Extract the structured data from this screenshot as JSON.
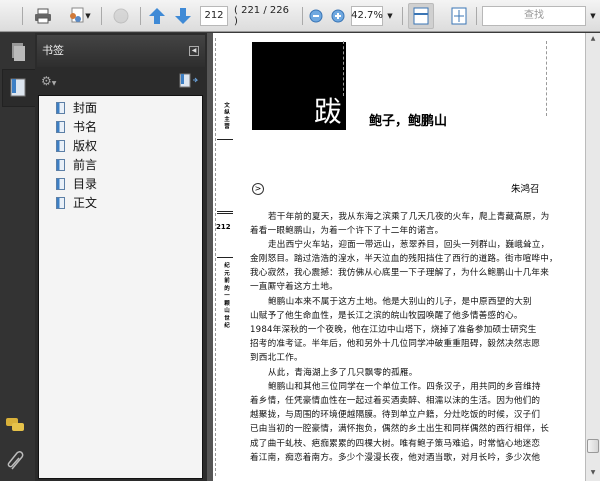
{
  "toolbar": {
    "page_number": "212",
    "page_count": "( 221 / 226 )",
    "zoom": "42.7%",
    "search_placeholder": "查找"
  },
  "panel": {
    "title": "书签",
    "bookmarks": [
      "封面",
      "书名",
      "版权",
      "前言",
      "目录",
      "正文"
    ]
  },
  "document": {
    "drop_char": "跋",
    "title": "鲍子，鲍鹏山",
    "author": "朱鸿召",
    "side_header": "文纵主营",
    "page_number": "212",
    "side_footer": "纪元前的一颗山世纪",
    "lines": [
      "若干年前的夏天，我从东海之滨乘了几天几夜的火车，爬上青藏高原，为",
      "着看一眼鲍鹏山，为着一个许下了十二年的诺言。",
      "走出西宁火车站，迎面一带远山，葱翠养目，回头一列群山，巍峨耸立，",
      "金刚怒目。踏过浩浩的湟水，半天泣血的残阳挡住了西行的道路。街市喧哗中，",
      "我心寂然，我心震撼：我仿佛从心底里一下子理解了，为什么鲍鹏山十几年来",
      "一直厮守着这方土地。",
      "鲍鹏山本来不属于这方土地。他是大别山的儿子，是中原西望的大别",
      "山赋予了他生命血性，是长江之滨的皖山牧园唤醒了他多情善感的心。",
      "1984年深秋的一个夜晚，他在江边中山塔下，烧掉了准备参加硕士研究生",
      "招考的准考证。半年后，他和另外十几位同学冲破重重阻碍，毅然决然志愿",
      "到西北工作。",
      "从此，青海湖上多了几只飘零的孤雁。",
      "鲍鹏山和其他三位同学在一个单位工作。四条汉子，用共同的乡音维持",
      "着乡情，任凭豪情血性在一起过着买酒卖醉、相濡以沫的生活。因为他们的",
      "越聚拢，与周围的环境便越隔膜。待到单立户籍，分灶吃饭的时候，汉子们",
      "已由当初的一腔豪情，满怀抱负，偶然的乡土出生和同样偶然的西行相伴，长",
      "成了曲干虬枝、疤痂累累的四棵大树。唯有鲍子策马难追，时常惦心地迷恋",
      "着江南，痴恋着南方。多少个漫漫长夜，他对酒当歌，对月长吟，多少次他"
    ]
  }
}
